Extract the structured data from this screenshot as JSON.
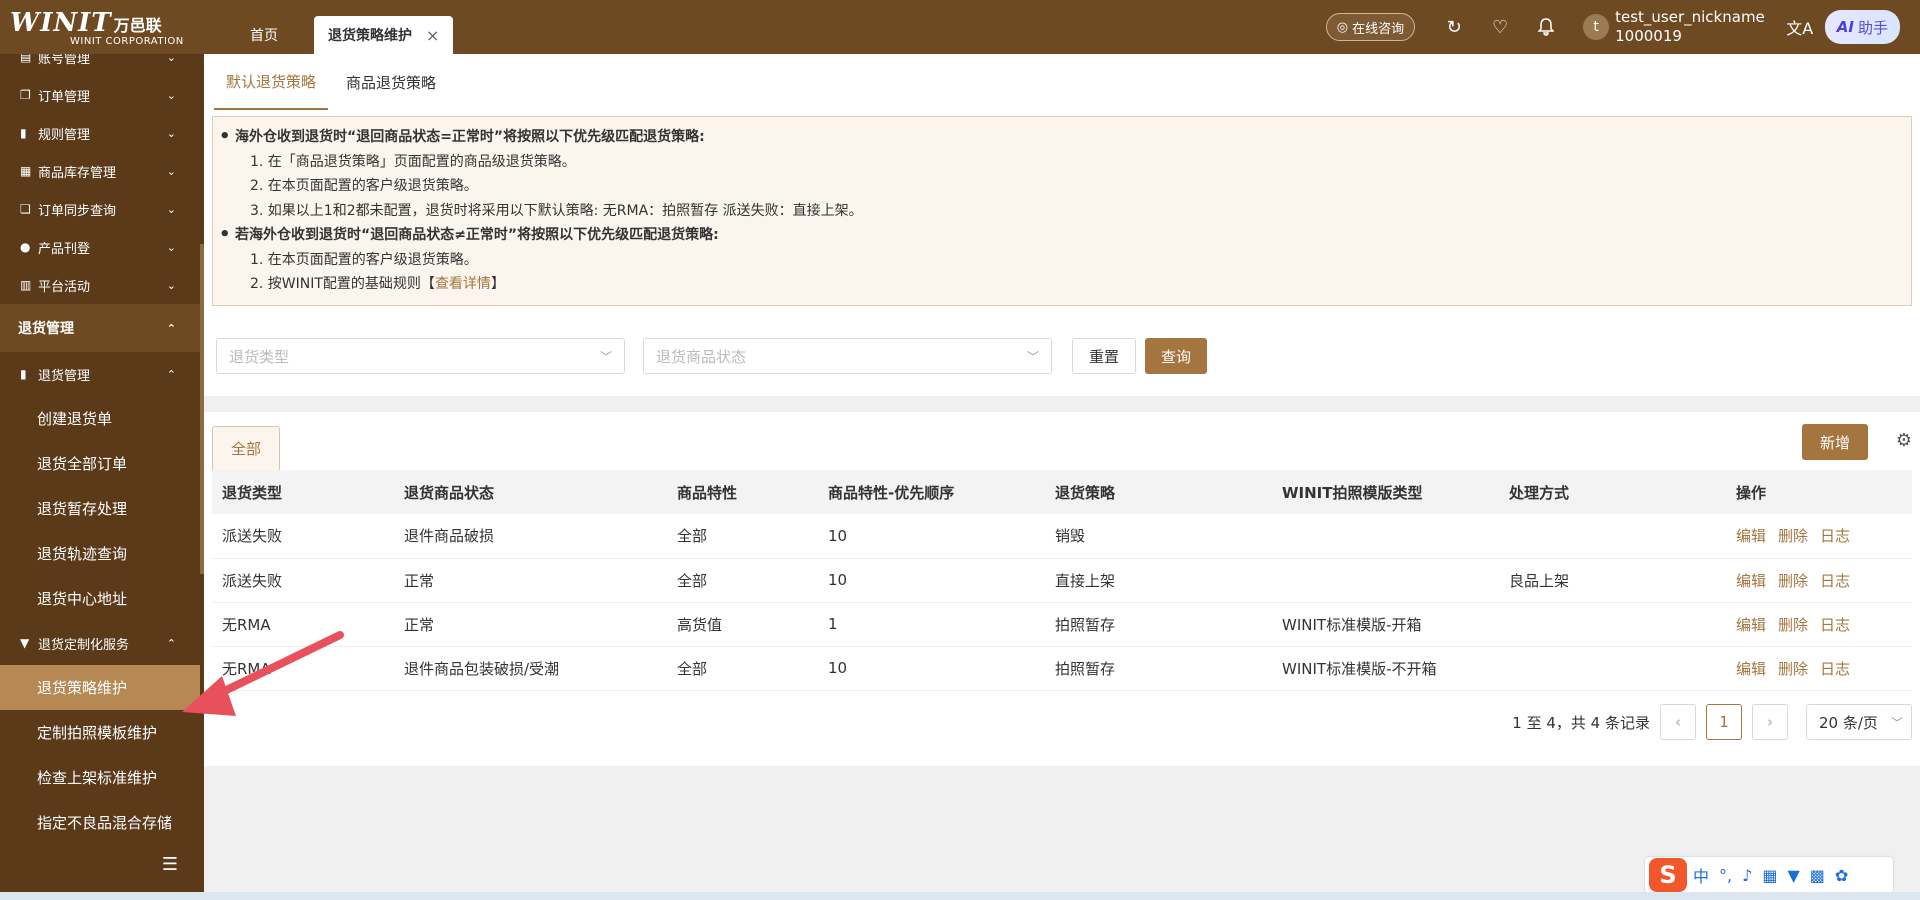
{
  "header": {
    "logo_brand": "WINIT",
    "logo_cn": "万邑联",
    "logo_sub": "WINIT CORPORATION",
    "tabs": [
      {
        "label": "首页"
      },
      {
        "label": "退货策略维护",
        "close": "×"
      }
    ],
    "consult_label": "在线咨询",
    "user_name": "test_user_nickname",
    "user_id": "1000019",
    "avatar_letter": "t",
    "ai_label": "助手",
    "ai_prefix": "AI"
  },
  "sidebar": {
    "items": [
      {
        "label": "账号管理",
        "icon": "doc-icon"
      },
      {
        "label": "订单管理",
        "icon": "copy-icon"
      },
      {
        "label": "规则管理",
        "icon": "book-icon"
      },
      {
        "label": "商品库存管理",
        "icon": "store-icon"
      },
      {
        "label": "订单同步查询",
        "icon": "sync-icon"
      },
      {
        "label": "产品刊登",
        "icon": "drop-icon"
      },
      {
        "label": "平台活动",
        "icon": "shop-icon"
      }
    ],
    "group": "退货管理",
    "sub_group": "退货管理",
    "sub_items": [
      "创建退货单",
      "退货全部订单",
      "退货暂存处理",
      "退货轨迹查询",
      "退货中心地址"
    ],
    "custom_group": "退货定制化服务",
    "custom_items": [
      "退货策略维护",
      "定制拍照模板维护",
      "检查上架标准维护",
      "指定不良品混合存储"
    ],
    "active_item": "退货策略维护"
  },
  "subtabs": [
    "默认退货策略",
    "商品退货策略"
  ],
  "notice": {
    "line1": "海外仓收到退货时“退回商品状态=正常时”将按照以下优先级匹配退货策略:",
    "line1_items": [
      "1. 在「商品退货策略」页面配置的商品级退货策略。",
      "2. 在本页面配置的客户级退货策略。",
      "3. 如果以上1和2都未配置，退货时将采用以下默认策略: 无RMA：拍照暂存 派送失败：直接上架。"
    ],
    "line2": "若海外仓收到退货时“退回商品状态≠正常时”将按照以下优先级匹配退货策略:",
    "line2_items": [
      "1. 在本页面配置的客户级退货策略。"
    ],
    "line2_last_prefix": "2. 按WINIT配置的基础规则【",
    "line2_last_link": "查看详情",
    "line2_last_suffix": "】"
  },
  "filters": {
    "type_placeholder": "退货类型",
    "status_placeholder": "退货商品状态",
    "reset_label": "重置",
    "query_label": "查询"
  },
  "table": {
    "tab_label": "全部",
    "add_label": "新增",
    "columns": [
      "退货类型",
      "退货商品状态",
      "商品特性",
      "商品特性-优先顺序",
      "退货策略",
      "WINIT拍照模版类型",
      "处理方式",
      "操作"
    ],
    "rows": [
      [
        "派送失败",
        "退件商品破损",
        "全部",
        "10",
        "销毁",
        "",
        ""
      ],
      [
        "派送失败",
        "正常",
        "全部",
        "10",
        "直接上架",
        "",
        "良品上架"
      ],
      [
        "无RMA",
        "正常",
        "高货值",
        "1",
        "拍照暂存",
        "WINIT标准模版-开箱",
        ""
      ],
      [
        "无RMA",
        "退件商品包装破损/受潮",
        "全部",
        "10",
        "拍照暂存",
        "WINIT标准模版-不开箱",
        ""
      ]
    ],
    "actions": [
      "编辑",
      "删除",
      "日志"
    ]
  },
  "pagination": {
    "summary": "1 至 4，共 4 条记录",
    "current_page": "1",
    "page_size": "20 条/页"
  },
  "ime": {
    "logo": "S",
    "mode": "中"
  },
  "colors": {
    "topbar": "#6e4a22",
    "sidebar": "#5b3a1a",
    "accent": "#a5753f",
    "arrow": "#e8505b"
  }
}
